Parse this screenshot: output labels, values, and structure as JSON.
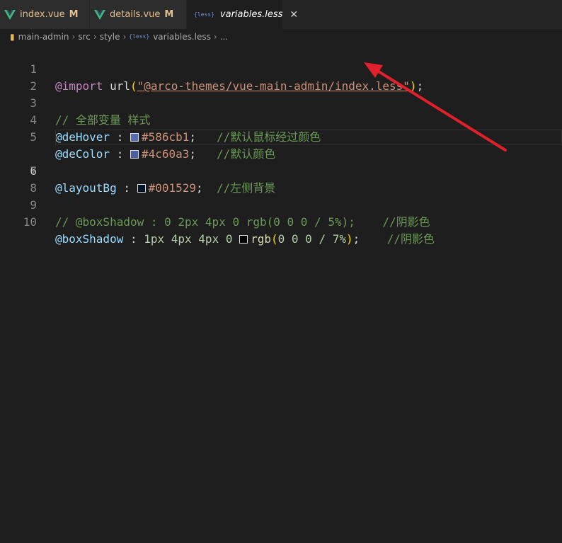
{
  "tabs": [
    {
      "name": "index.vue",
      "badge": "M"
    },
    {
      "name": "details.vue",
      "badge": "M"
    },
    {
      "name": "variables.less",
      "icon_text": "{less}",
      "close": "✕"
    }
  ],
  "breadcrumb": {
    "items": [
      "main-admin",
      "src",
      "style",
      "variables.less",
      "..."
    ],
    "less_icon_text": "{less}"
  },
  "editor": {
    "line_numbers": [
      "1",
      "2",
      "3",
      "4",
      "5",
      "6",
      "7",
      "8",
      "9",
      "10"
    ],
    "line1": {
      "at": "@import",
      "fn": " url",
      "open": "(",
      "str": "\"@arco-themes/vue-main-admin/index.less\"",
      "close": ")",
      "semi": ";"
    },
    "line3": {
      "comment": "// 全部变量 样式"
    },
    "line4": {
      "var": "@deHover",
      "colon": " : ",
      "hex": "#586cb1",
      "semi": ";   ",
      "comment": "//默认鼠标经过颜色",
      "swatch_color": "#586cb1"
    },
    "line5": {
      "var": "@deColor",
      "colon": " : ",
      "hex": "#4c60a3",
      "semi": ";   ",
      "comment": "//默认颜色",
      "swatch_color": "#4c60a3"
    },
    "line7": {
      "var": "@layoutBg",
      "colon": " : ",
      "hex": "#001529",
      "semi": ";  ",
      "comment": "//左侧背景",
      "swatch_color": "#001529"
    },
    "line9": {
      "comment": "// @boxShadow : 0 2px 4px 0 rgb(0 0 0 / 5%);    //阴影色"
    },
    "line10": {
      "var": "@boxShadow",
      "colon": " : ",
      "nums": "1px 4px 4px 0 ",
      "fn": "rgb",
      "open": "(",
      "inner": "0 0 0 / 7%",
      "close": ")",
      "semi": ";    ",
      "comment": "//阴影色",
      "swatch_color": "#000000"
    }
  },
  "colors": {
    "annotation_arrow": "#e0202a"
  }
}
